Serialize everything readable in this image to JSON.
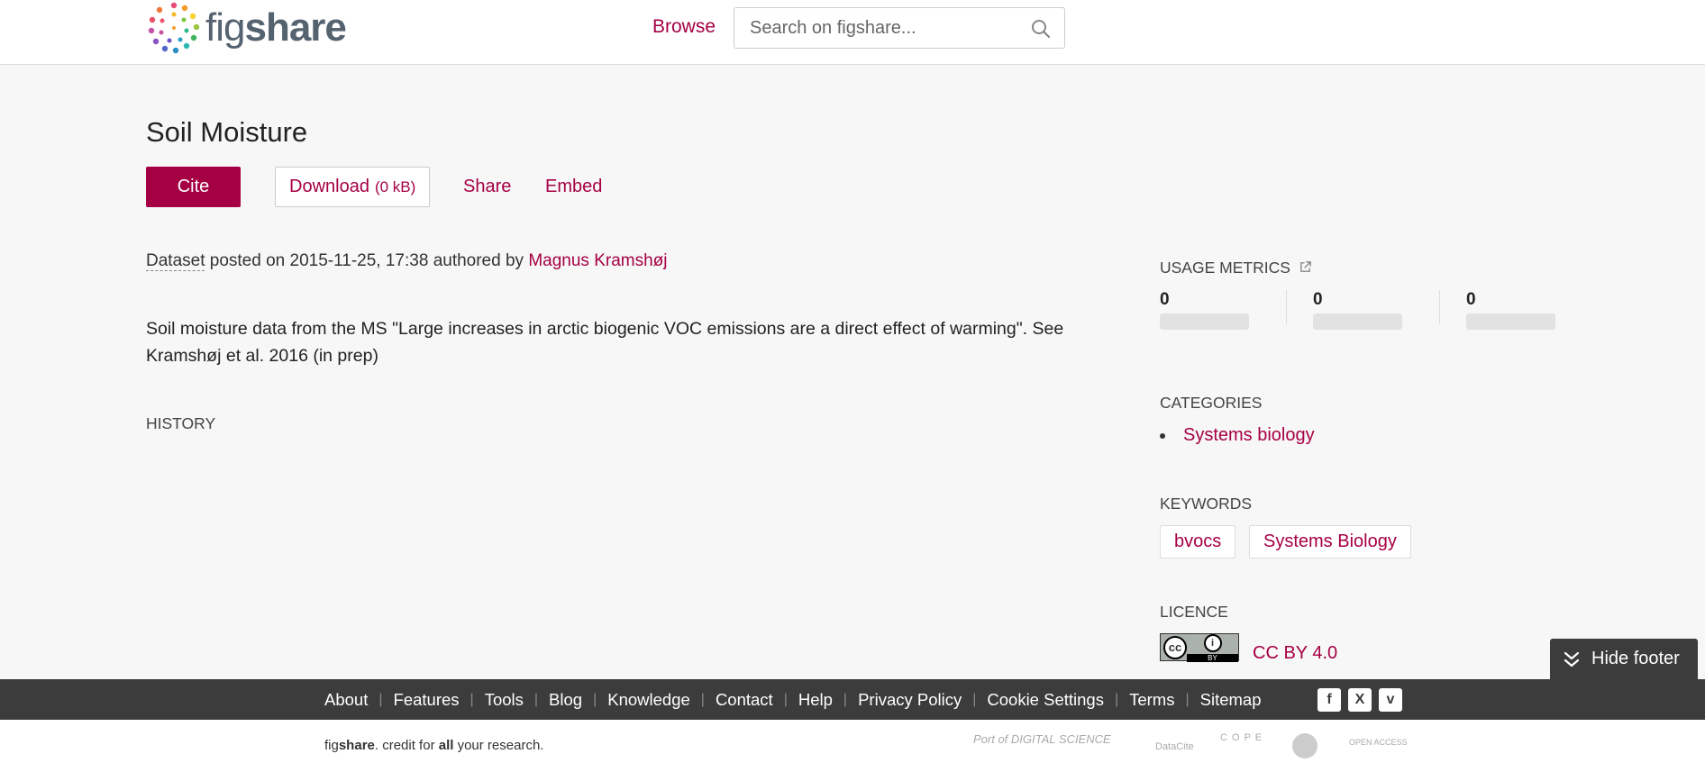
{
  "header": {
    "logo_prefix": "fig",
    "logo_suffix": "share",
    "nav_browse": "Browse",
    "search_placeholder": "Search on figshare..."
  },
  "item": {
    "title": "Soil Moisture",
    "actions": {
      "cite": "Cite",
      "download": "Download",
      "download_size": "(0 kB)",
      "share": "Share",
      "embed": "Embed"
    },
    "type": "Dataset",
    "posted_prefix": "posted on",
    "posted_date": "2015-11-25, 17:38",
    "authored_prefix": "authored by",
    "author": "Magnus Kramshøj",
    "description": "Soil moisture data from the MS \"Large increases in arctic biogenic VOC emissions are a direct effect of warming\". See Kramshøj et al. 2016 (in prep)",
    "history_label": "HISTORY"
  },
  "sidebar": {
    "usage_metrics_label": "USAGE METRICS",
    "metrics": [
      "0",
      "0",
      "0"
    ],
    "categories_label": "CATEGORIES",
    "categories": [
      "Systems biology"
    ],
    "keywords_label": "KEYWORDS",
    "keywords": [
      "bvocs",
      "Systems Biology"
    ],
    "licence_label": "LICENCE",
    "licence": "CC BY 4.0",
    "licence_badge_text": "BY"
  },
  "hide_footer": "Hide footer",
  "footer": {
    "links": [
      "About",
      "Features",
      "Tools",
      "Blog",
      "Knowledge",
      "Contact",
      "Help",
      "Privacy Policy",
      "Cookie Settings",
      "Terms",
      "Sitemap"
    ],
    "social": [
      "f",
      "X",
      "v"
    ],
    "tagline": {
      "part1": "fig",
      "part2": "share",
      "part3": ". credit for ",
      "part4": "all",
      "part5": " your research."
    },
    "partners": [
      "Port of DIGITAL SCIENCE",
      "DataCite",
      "C O P E",
      "OPEN ACCESS"
    ]
  },
  "colors": {
    "accent": "#a50044",
    "footer_bg": "#3c3c3c",
    "page_bg": "#f7f7f7"
  }
}
